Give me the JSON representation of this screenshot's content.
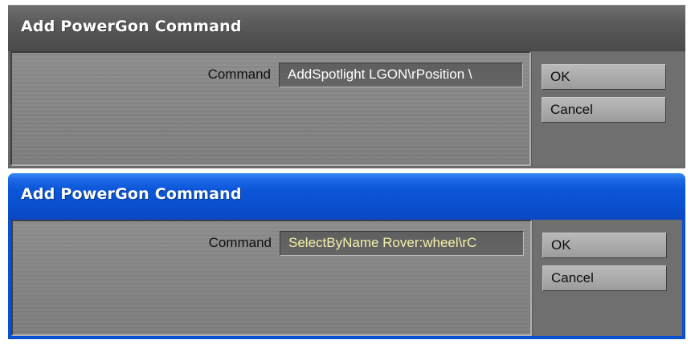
{
  "dialogs": [
    {
      "title": "Add PowerGon Command",
      "theme": "classic-gray",
      "command_label": "Command",
      "command_value": "AddSpotlight LGON\\rPosition \\",
      "ok_label": "OK",
      "cancel_label": "Cancel"
    },
    {
      "title": "Add PowerGon Command",
      "theme": "xp-blue",
      "command_label": "Command",
      "command_value": "SelectByName Rover:wheel\\rC",
      "ok_label": "OK",
      "cancel_label": "Cancel"
    }
  ],
  "colors": {
    "titlebar_gray": "#5a5a5a",
    "titlebar_blue": "#0b56d8",
    "panel_gray": "#858585",
    "input_text_default": "#ffffff",
    "input_text_active": "#f4f1a8"
  }
}
